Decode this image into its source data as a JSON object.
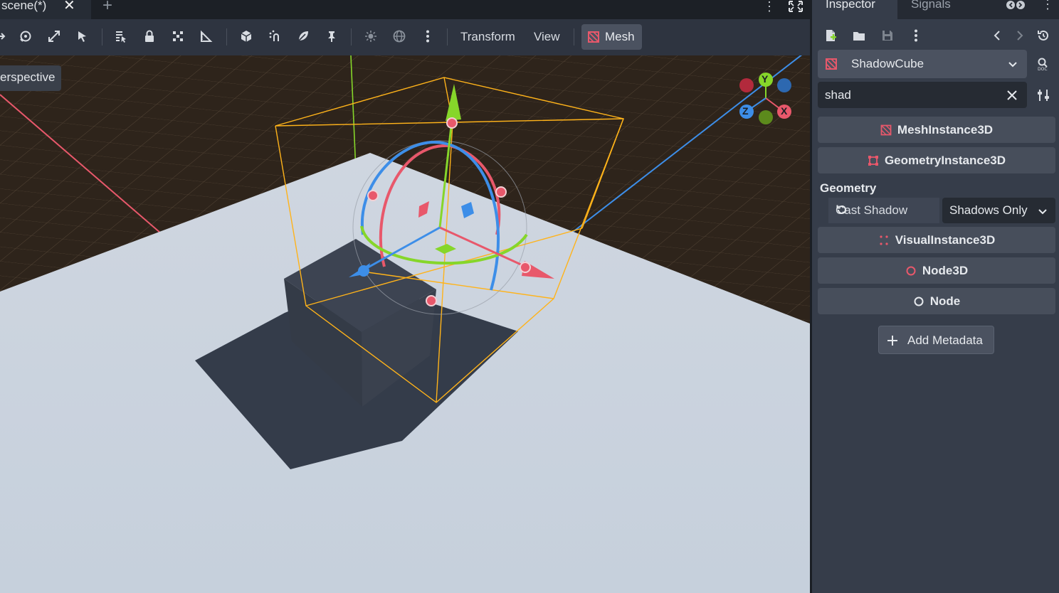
{
  "editor": {
    "scene_tab_label": "scene(*)",
    "toolbar": {
      "transform_label": "Transform",
      "view_label": "View",
      "mesh_label": "Mesh"
    },
    "viewport": {
      "view_mode_label": "erspective"
    },
    "gizmo": {
      "y_label": "Y",
      "z_label": "Z",
      "x_label": "X"
    }
  },
  "inspector": {
    "tabs": [
      {
        "label": "Inspector"
      },
      {
        "label": "Signals"
      }
    ],
    "selected_node": "ShadowCube",
    "filter_value": "shad",
    "sections": {
      "mesh_instance": "MeshInstance3D",
      "geometry_instance": "GeometryInstance3D",
      "geometry_group": "Geometry",
      "visual_instance": "VisualInstance3D",
      "node3d": "Node3D",
      "node": "Node"
    },
    "property": {
      "name": "Cast Shadow",
      "value": "Shadows Only"
    },
    "add_metadata_label": "Add Metadata"
  },
  "colors": {
    "accent_red": "#e8586b",
    "axis_green": "#86d62a",
    "axis_blue": "#3d8ee8",
    "selection_orange": "#ffb31a",
    "panel_bg": "#363d4a"
  }
}
